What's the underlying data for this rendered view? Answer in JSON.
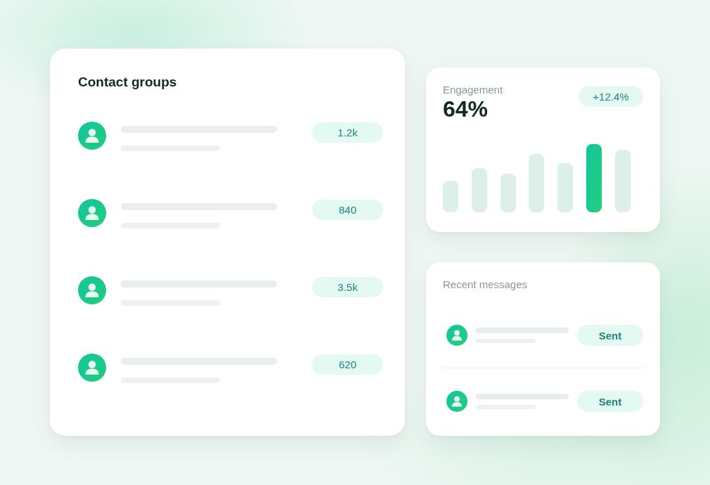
{
  "contact_groups": {
    "title": "Contact groups",
    "groups": [
      {
        "count": "1.2k"
      },
      {
        "count": "840"
      },
      {
        "count": "3.5k"
      },
      {
        "count": "620"
      }
    ]
  },
  "engagement": {
    "label": "Engagement",
    "value": "64%",
    "change": "+12.4%"
  },
  "recent_messages": {
    "title": "Recent messages",
    "messages": [
      {
        "status": "Sent"
      },
      {
        "status": "Sent"
      }
    ]
  }
}
